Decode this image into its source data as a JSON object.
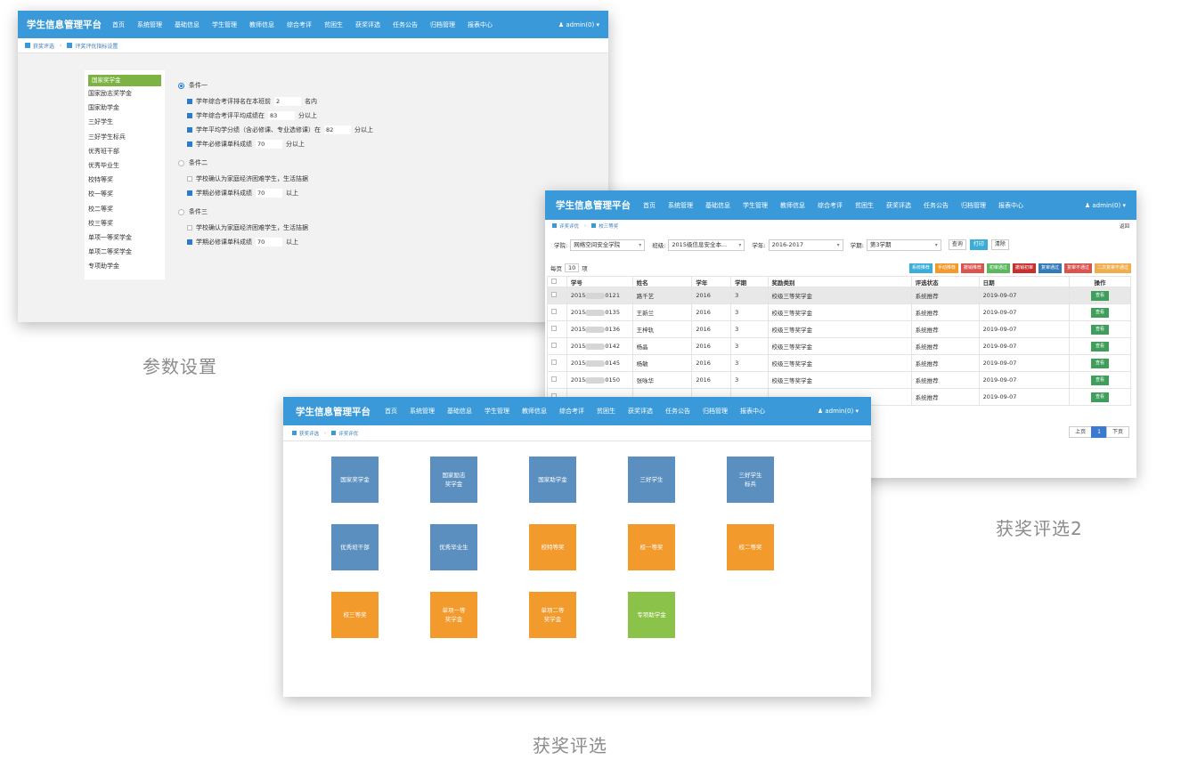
{
  "nav": {
    "brand": "学生信息管理平台",
    "items": [
      "首页",
      "系统管理",
      "基础信息",
      "学生管理",
      "教师信息",
      "综合考评",
      "贫困生",
      "获奖评选",
      "任务公告",
      "归档管理",
      "报表中心"
    ],
    "user": "admin(0)"
  },
  "params_window": {
    "breadcrumb": [
      "获奖评选",
      "评奖评优指标设置"
    ],
    "awards": [
      "国家奖学金",
      "国家励志奖学金",
      "国家助学金",
      "三好学生",
      "三好学生标兵",
      "优秀班干部",
      "优秀毕业生",
      "校特等奖",
      "校一等奖",
      "校二等奖",
      "校三等奖",
      "单项一等奖学金",
      "单项二等奖学金",
      "专项助学金"
    ],
    "active_award": "国家奖学金",
    "conditions": [
      {
        "title": "条件一",
        "selected": true,
        "rows": [
          {
            "checked": true,
            "pre": "学年综合考评排名在本班前",
            "value": "2",
            "post": "名内"
          },
          {
            "checked": true,
            "pre": "学年综合考评平均成绩在",
            "value": "83",
            "post": "分以上"
          },
          {
            "checked": true,
            "pre": "学年平均学分绩（含必修课、专业选修课）在",
            "value": "82",
            "post": "分以上"
          },
          {
            "checked": true,
            "pre": "学年必修课单科成绩",
            "value": "70",
            "post": "分以上"
          }
        ]
      },
      {
        "title": "条件二",
        "selected": false,
        "rows": [
          {
            "checked": false,
            "pre": "学校确认为家庭经济困难学生，生活拮据",
            "value": null,
            "post": ""
          },
          {
            "checked": true,
            "pre": "学期必修课单科成绩",
            "value": "70",
            "post": "以上"
          }
        ]
      },
      {
        "title": "条件三",
        "selected": false,
        "rows": [
          {
            "checked": false,
            "pre": "学校确认为家庭经济困难学生，生活拮据",
            "value": null,
            "post": ""
          },
          {
            "checked": true,
            "pre": "学期必修课单科成绩",
            "value": "70",
            "post": "以上"
          }
        ]
      }
    ],
    "caption": "参数设置"
  },
  "list_window": {
    "breadcrumb": [
      "评奖评优",
      "校三等奖"
    ],
    "back": "返回",
    "filters": {
      "college_label": "学院:",
      "college": "网络空间安全学院",
      "class_label": "班级:",
      "class": "2015级信息安全本...",
      "year_label": "学年:",
      "year": "2016-2017",
      "term_label": "学期:",
      "term": "第3学期",
      "query": "查询",
      "print": "打印",
      "clear": "清除"
    },
    "per_page": {
      "pre": "每页",
      "value": "10",
      "post": "项"
    },
    "actions": [
      {
        "label": "系统推荐",
        "color": "#3aaed8"
      },
      {
        "label": "手动推荐",
        "color": "#f39a2c"
      },
      {
        "label": "撤销推荐",
        "color": "#d9534f"
      },
      {
        "label": "初审通过",
        "color": "#5cb85c"
      },
      {
        "label": "撤销初审",
        "color": "#c9302c"
      },
      {
        "label": "复审通过",
        "color": "#337ab7"
      },
      {
        "label": "复审不通过",
        "color": "#d9534f"
      },
      {
        "label": "二次复审不通过",
        "color": "#f0ad4e"
      }
    ],
    "columns": [
      "",
      "学号",
      "姓名",
      "学年",
      "学期",
      "奖励类别",
      "评选状态",
      "日期",
      "操作"
    ],
    "rows": [
      {
        "id_pre": "2015",
        "id_post": "0121",
        "name": "路千艺",
        "year": "2016",
        "term": "3",
        "award": "校级三等奖学金",
        "status": "系统推荐",
        "date": "2019-09-07",
        "op": "查看"
      },
      {
        "id_pre": "2015",
        "id_post": "0135",
        "name": "王新兰",
        "year": "2016",
        "term": "3",
        "award": "校级三等奖学金",
        "status": "系统推荐",
        "date": "2019-09-07",
        "op": "查看"
      },
      {
        "id_pre": "2015",
        "id_post": "0136",
        "name": "王梓轨",
        "year": "2016",
        "term": "3",
        "award": "校级三等奖学金",
        "status": "系统推荐",
        "date": "2019-09-07",
        "op": "查看"
      },
      {
        "id_pre": "2015",
        "id_post": "0142",
        "name": "杨晶",
        "year": "2016",
        "term": "3",
        "award": "校级三等奖学金",
        "status": "系统推荐",
        "date": "2019-09-07",
        "op": "查看"
      },
      {
        "id_pre": "2015",
        "id_post": "0145",
        "name": "杨敏",
        "year": "2016",
        "term": "3",
        "award": "校级三等奖学金",
        "status": "系统推荐",
        "date": "2019-09-07",
        "op": "查看"
      },
      {
        "id_pre": "2015",
        "id_post": "0150",
        "name": "张咏华",
        "year": "2016",
        "term": "3",
        "award": "校级三等奖学金",
        "status": "系统推荐",
        "date": "2019-09-07",
        "op": "查看"
      },
      {
        "id_pre": "",
        "id_post": "",
        "name": "",
        "year": "",
        "term": "",
        "award": "",
        "status": "系统推荐",
        "date": "2019-09-07",
        "op": "查看"
      }
    ],
    "pager": {
      "prev": "上页",
      "current": "1",
      "next": "下页"
    },
    "caption": "获奖评选2"
  },
  "tiles_window": {
    "breadcrumb": [
      "获奖评选",
      "评奖评优"
    ],
    "tiles": [
      {
        "label": "国家奖学金",
        "color": "blue"
      },
      {
        "label": "国家励志\n奖学金",
        "color": "blue"
      },
      {
        "label": "国家助学金",
        "color": "blue"
      },
      {
        "label": "三好学生",
        "color": "blue"
      },
      {
        "label": "三好学生\n标兵",
        "color": "blue"
      },
      {
        "label": "优秀班干部",
        "color": "blue"
      },
      {
        "label": "优秀毕业生",
        "color": "blue"
      },
      {
        "label": "校特等奖",
        "color": "orange"
      },
      {
        "label": "校一等奖",
        "color": "orange"
      },
      {
        "label": "校二等奖",
        "color": "orange"
      },
      {
        "label": "校三等奖",
        "color": "orange"
      },
      {
        "label": "单项一等\n奖学金",
        "color": "orange"
      },
      {
        "label": "单项二等\n奖学金",
        "color": "orange"
      },
      {
        "label": "专项助学金",
        "color": "green"
      }
    ],
    "caption": "获奖评选"
  }
}
